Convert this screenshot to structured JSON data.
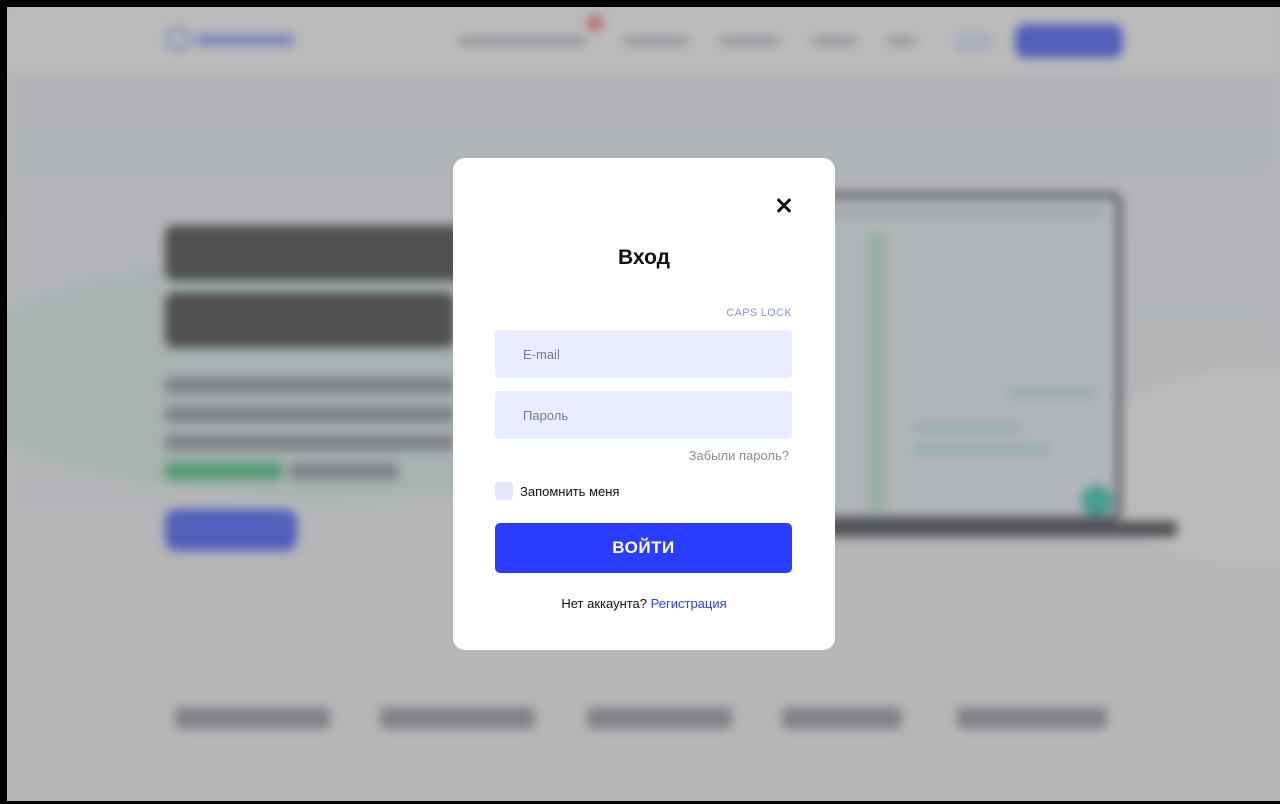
{
  "modal": {
    "title": "Вход",
    "caps_lock_hint": "CAPS LOCK",
    "email": {
      "value": "",
      "placeholder": "E-mail"
    },
    "password": {
      "value": "",
      "placeholder": "Пароль"
    },
    "forgot_password": "Забыли пароль?",
    "remember_me": {
      "label": "Запомнить меня",
      "checked": false
    },
    "submit_label": "ВОЙТИ",
    "no_account_text": "Нет аккаунта?",
    "register_link": "Регистрация",
    "close_icon": "close-icon"
  },
  "colors": {
    "accent": "#2a3dff",
    "field_bg": "#eaedff",
    "caps_lock": "#8a94d8",
    "overlay": "rgba(120,120,120,0.5)"
  }
}
